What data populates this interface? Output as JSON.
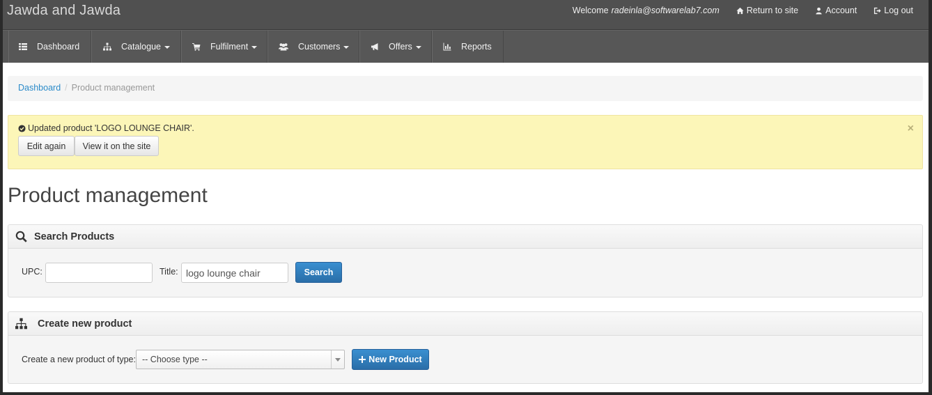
{
  "header": {
    "brand": "Jawda and Jawda",
    "welcome_prefix": "Welcome",
    "user_email": "radeinla@softwarelab7.com",
    "return_to_site": "Return to site",
    "account": "Account",
    "log_out": "Log out"
  },
  "nav": {
    "items": [
      {
        "label": "Dashboard",
        "icon": "list-icon"
      },
      {
        "label": "Catalogue",
        "icon": "sitemap-icon"
      },
      {
        "label": "Fulfilment",
        "icon": "shopping-cart-icon"
      },
      {
        "label": "Customers",
        "icon": "group-icon"
      },
      {
        "label": "Offers",
        "icon": "bullhorn-icon"
      },
      {
        "label": "Reports",
        "icon": "bar-chart-icon"
      }
    ]
  },
  "breadcrumb": {
    "home": "Dashboard",
    "separator": "/",
    "current": "Product management"
  },
  "alert": {
    "message": "Updated product 'LOGO LOUNGE CHAIR'.",
    "edit_again": "Edit again",
    "view_on_site": "View it on the site",
    "close": "×"
  },
  "page": {
    "title": "Product management"
  },
  "search_panel": {
    "title": "Search Products",
    "upc_label": "UPC:",
    "upc_value": "",
    "title_label": "Title:",
    "title_value": "logo lounge chair",
    "search_button": "Search"
  },
  "create_panel": {
    "title": "Create new product",
    "type_label": "Create a new product of type:",
    "type_selected": "-- Choose type --",
    "new_product_button": "New Product"
  },
  "colors": {
    "header_bg": "#505050",
    "nav_bg": "#575757",
    "alert_bg": "#fcf6b8",
    "primary": "#2a7dbf",
    "link": "#2a8ac9"
  }
}
